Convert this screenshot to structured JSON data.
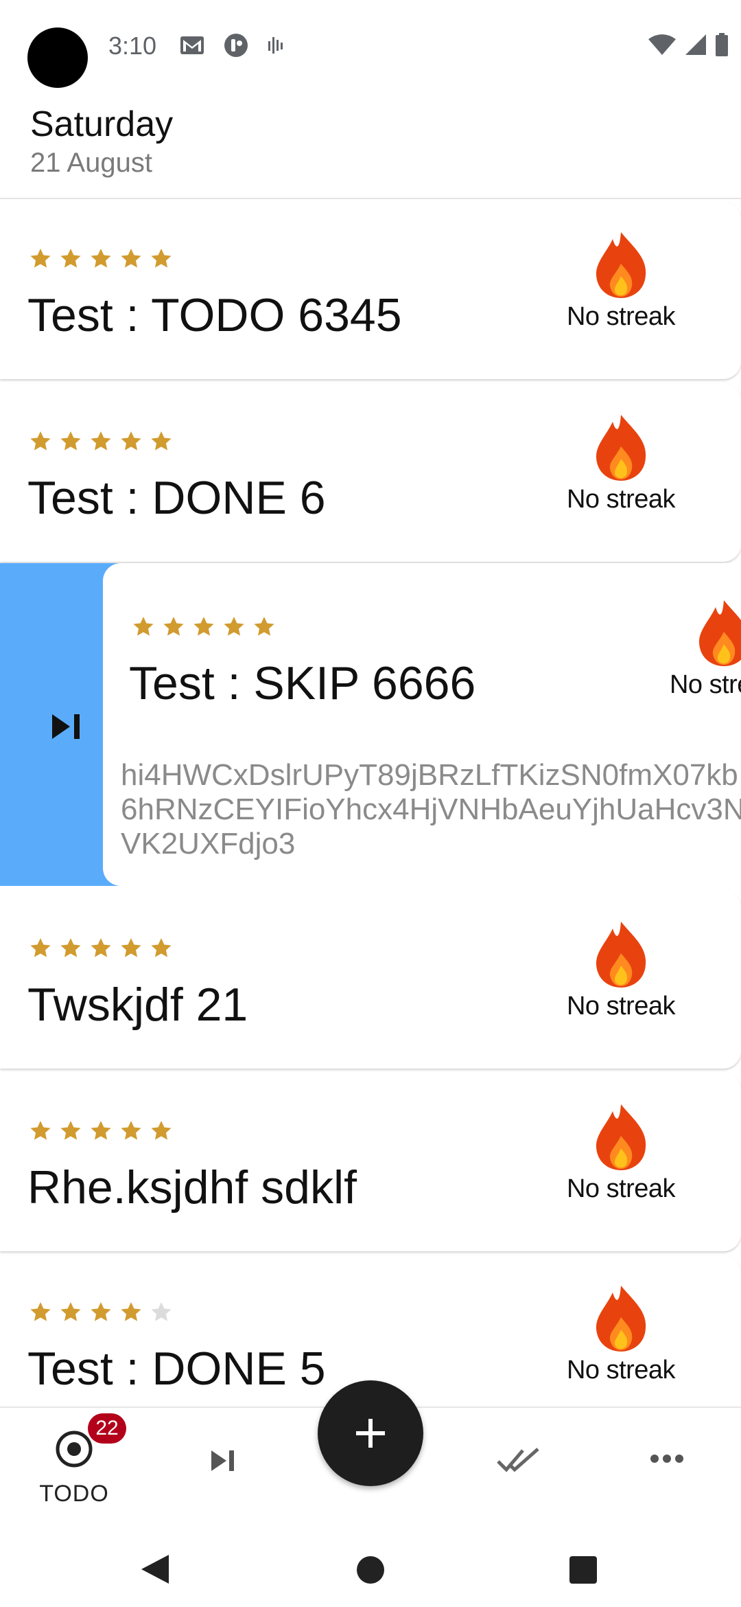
{
  "status_bar": {
    "time": "3:10",
    "icons_left": [
      "gmail-icon",
      "app-icon",
      "signal-bars-icon"
    ],
    "icons_right": [
      "wifi-icon",
      "cellular-icon",
      "battery-icon"
    ]
  },
  "header": {
    "day": "Saturday",
    "date": "21 August"
  },
  "tasks": [
    {
      "title": "Test : TODO 6345",
      "rating": 5,
      "streak": "No streak"
    },
    {
      "title": "Test : DONE 6",
      "rating": 5,
      "streak": "No streak"
    },
    {
      "title": "Test : SKIP 6666",
      "rating": 5,
      "streak": "No streak",
      "description": "hi4HWCxDslrUPyT89jBRzLfTKizSN0fmX07kb\n6hRNzCEYIFioYhcx4HjVNHbAeuYjhUaHcv3N\nVK2UXFdjo3"
    },
    {
      "title": "Twskjdf 21",
      "rating": 5,
      "streak": "No streak"
    },
    {
      "title": "Rhe.ksjdhf sdklf",
      "rating": 5,
      "streak": "No streak"
    },
    {
      "title": "Test : DONE 5",
      "rating": 4,
      "streak": "No streak"
    }
  ],
  "swipe_action": {
    "icon": "skip-next-icon",
    "color": "#5aacfb"
  },
  "bottom_nav": {
    "todo_label": "TODO",
    "todo_badge": "22",
    "items": [
      "todo-icon",
      "skip-next-icon",
      "add-icon",
      "done-all-icon",
      "more-horizontal-icon"
    ]
  },
  "colors": {
    "star": "#d19b2f",
    "star_empty": "#dcdcdc",
    "flame_outer": "#e8430f",
    "flame_inner": "#ffc21a",
    "badge": "#b3001b",
    "fab": "#1e1e1e"
  }
}
